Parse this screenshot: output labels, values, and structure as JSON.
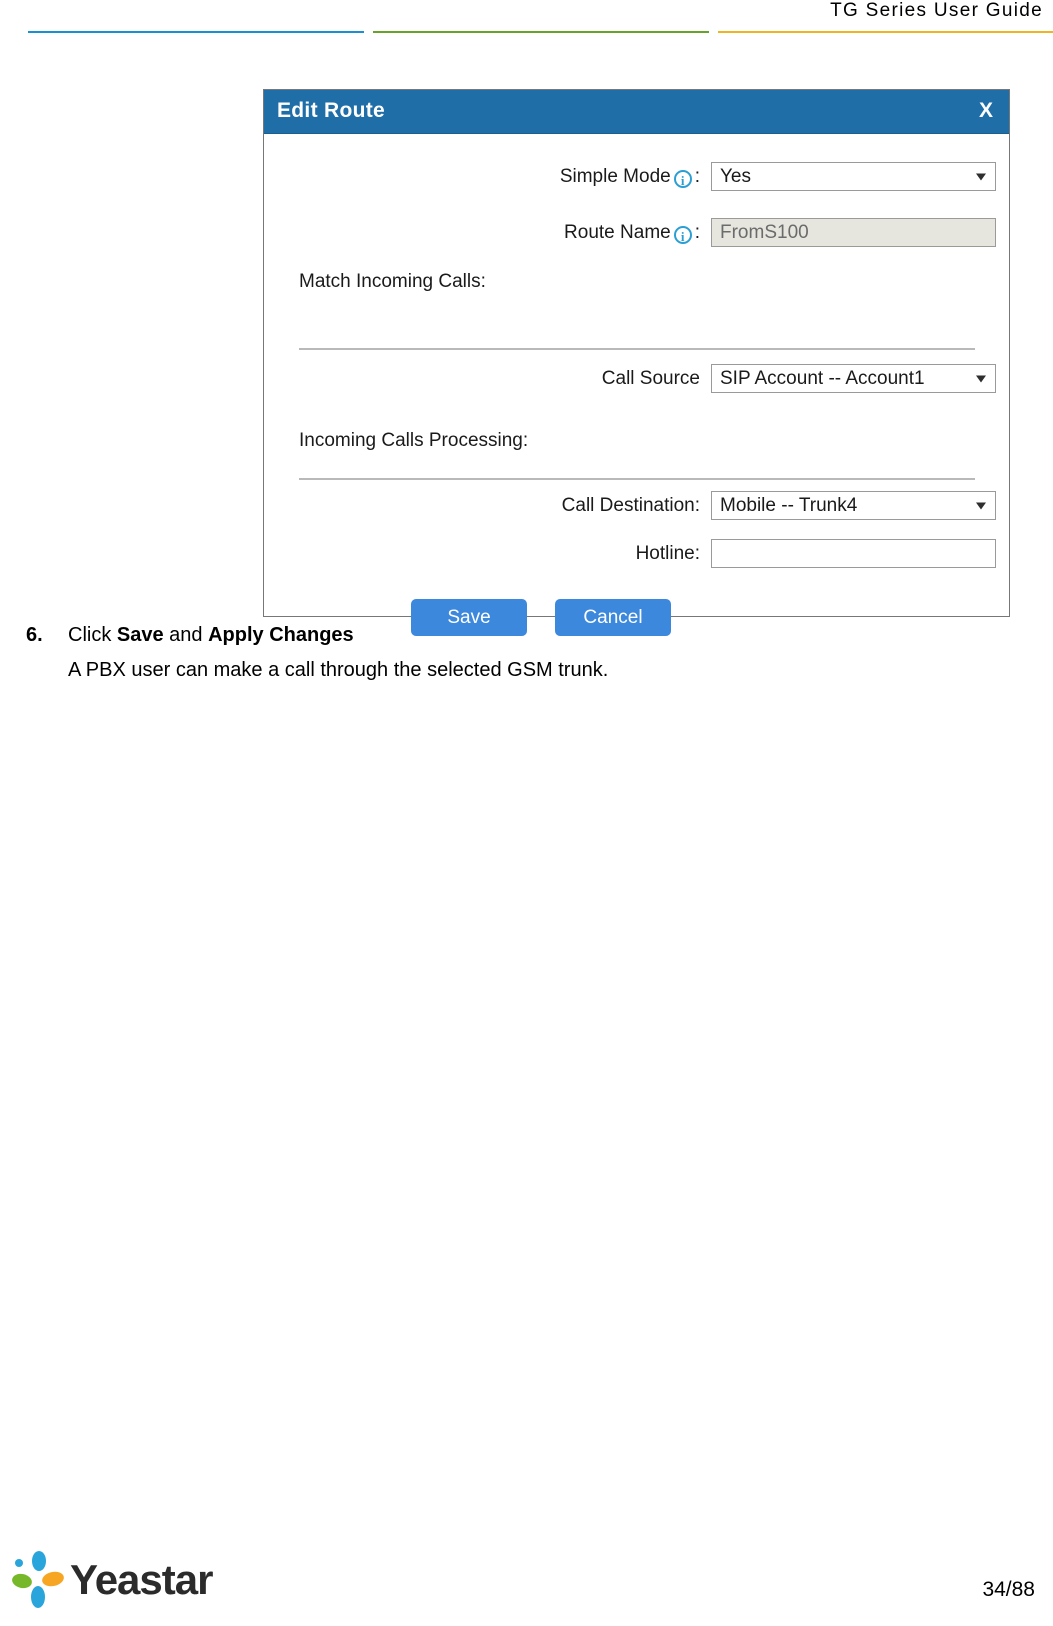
{
  "header": {
    "title": "TG  Series  User  Guide",
    "rule_colors": {
      "blue": "#1a8fd1",
      "green": "#67a22b",
      "yellow": "#f0b323"
    }
  },
  "dialog": {
    "title": "Edit Route",
    "close_label": "X",
    "titlebar_color": "#1f6ea8",
    "fields": [
      {
        "label": "Simple Mode",
        "has_info_icon": true,
        "colon": ":",
        "type": "select",
        "value": "Yes"
      },
      {
        "label": "Route Name",
        "has_info_icon": true,
        "colon": ":",
        "type": "text",
        "value": "FromS100",
        "disabled": true
      },
      {
        "label": "Call Source",
        "has_info_icon": false,
        "colon": "",
        "type": "select",
        "value": "SIP Account -- Account1"
      },
      {
        "label": "Call Destination:",
        "has_info_icon": false,
        "colon": "",
        "type": "select",
        "value": "Mobile -- Trunk4"
      },
      {
        "label": "Hotline:",
        "has_info_icon": false,
        "colon": "",
        "type": "text",
        "value": ""
      }
    ],
    "sections": [
      {
        "heading": "Match Incoming Calls:"
      },
      {
        "heading": "Incoming Calls Processing:"
      }
    ],
    "buttons": {
      "save": "Save",
      "cancel": "Cancel",
      "color": "#3c88dd"
    }
  },
  "step": {
    "number": "6.",
    "line1_prefix": "Click ",
    "line1_bold1": "Save",
    "line1_mid": " and ",
    "line1_bold2": "Apply  Changes",
    "line2": "A PBX user can make a call through the selected GSM trunk."
  },
  "footer": {
    "logo_text": "Yeastar",
    "logo_colors": {
      "blue": "#29a5db",
      "orange": "#f6a623",
      "green": "#77b82a"
    },
    "page_number": "34/88"
  }
}
